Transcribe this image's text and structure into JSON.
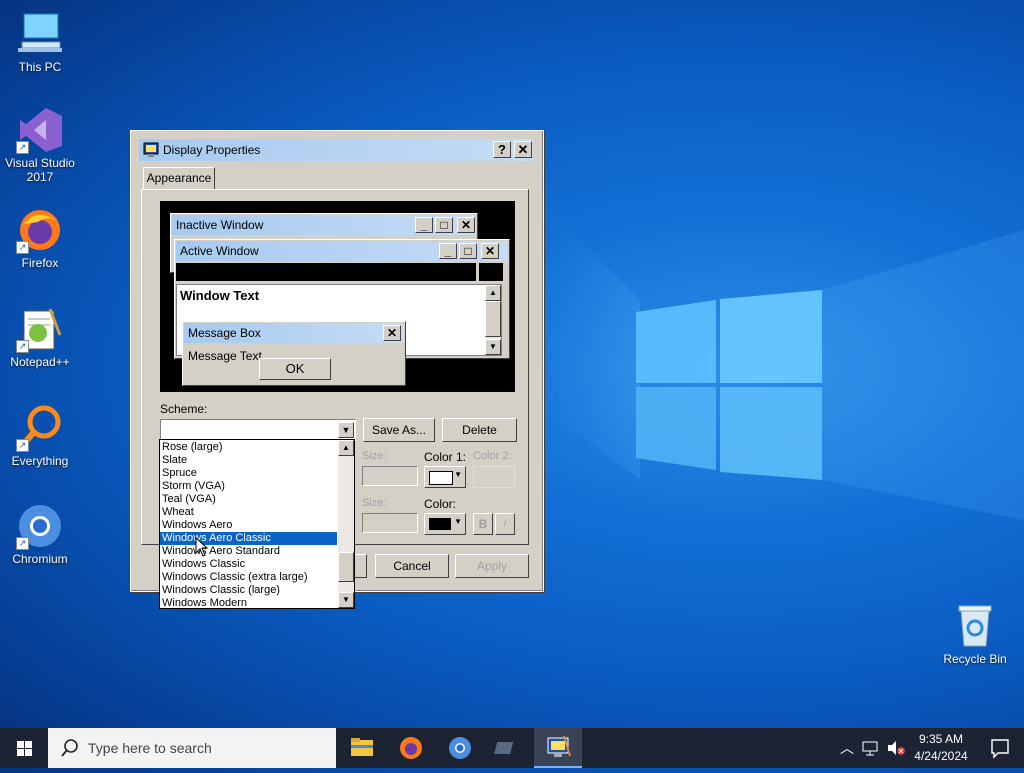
{
  "desktop": {
    "icons": [
      {
        "label": "This PC"
      },
      {
        "label": "Visual Studio\n2017"
      },
      {
        "label": "Firefox"
      },
      {
        "label": "Notepad++"
      },
      {
        "label": "Everything"
      },
      {
        "label": "Chromium"
      },
      {
        "label": "Recycle Bin"
      }
    ]
  },
  "dialog": {
    "title": "Display Properties",
    "help_btn": "?",
    "close_btn": "✕",
    "tab": "Appearance",
    "preview": {
      "inactive_title": "Inactive Window",
      "active_title": "Active Window",
      "window_text": "Window Text",
      "msgbox_title": "Message Box",
      "msg_text": "Message Text",
      "ok": "OK"
    },
    "scheme_label": "Scheme:",
    "save_as": "Save As...",
    "delete": "Delete",
    "size_label": "Size:",
    "color1_label": "Color 1:",
    "color2_label": "Color 2:",
    "size2_label": "Size:",
    "color_label": "Color:",
    "bold_btn": "B",
    "italic_btn": "I",
    "cancel": "Cancel",
    "apply": "Apply",
    "scheme_options": [
      "Rose (large)",
      "Slate",
      "Spruce",
      "Storm (VGA)",
      "Teal (VGA)",
      "Wheat",
      "Windows Aero",
      "Windows Aero Classic",
      "Windows Aero Standard",
      "Windows Classic",
      "Windows Classic (extra large)",
      "Windows Classic (large)",
      "Windows Modern"
    ],
    "selected_option": "Windows Aero Classic"
  },
  "taskbar": {
    "search_placeholder": "Type here to search",
    "time": "9:35 AM",
    "date": "4/24/2024"
  },
  "colors": {
    "title_gradient_start": "#a6caf0",
    "selection": "#0a64c8",
    "taskbar": "#1c2434"
  }
}
